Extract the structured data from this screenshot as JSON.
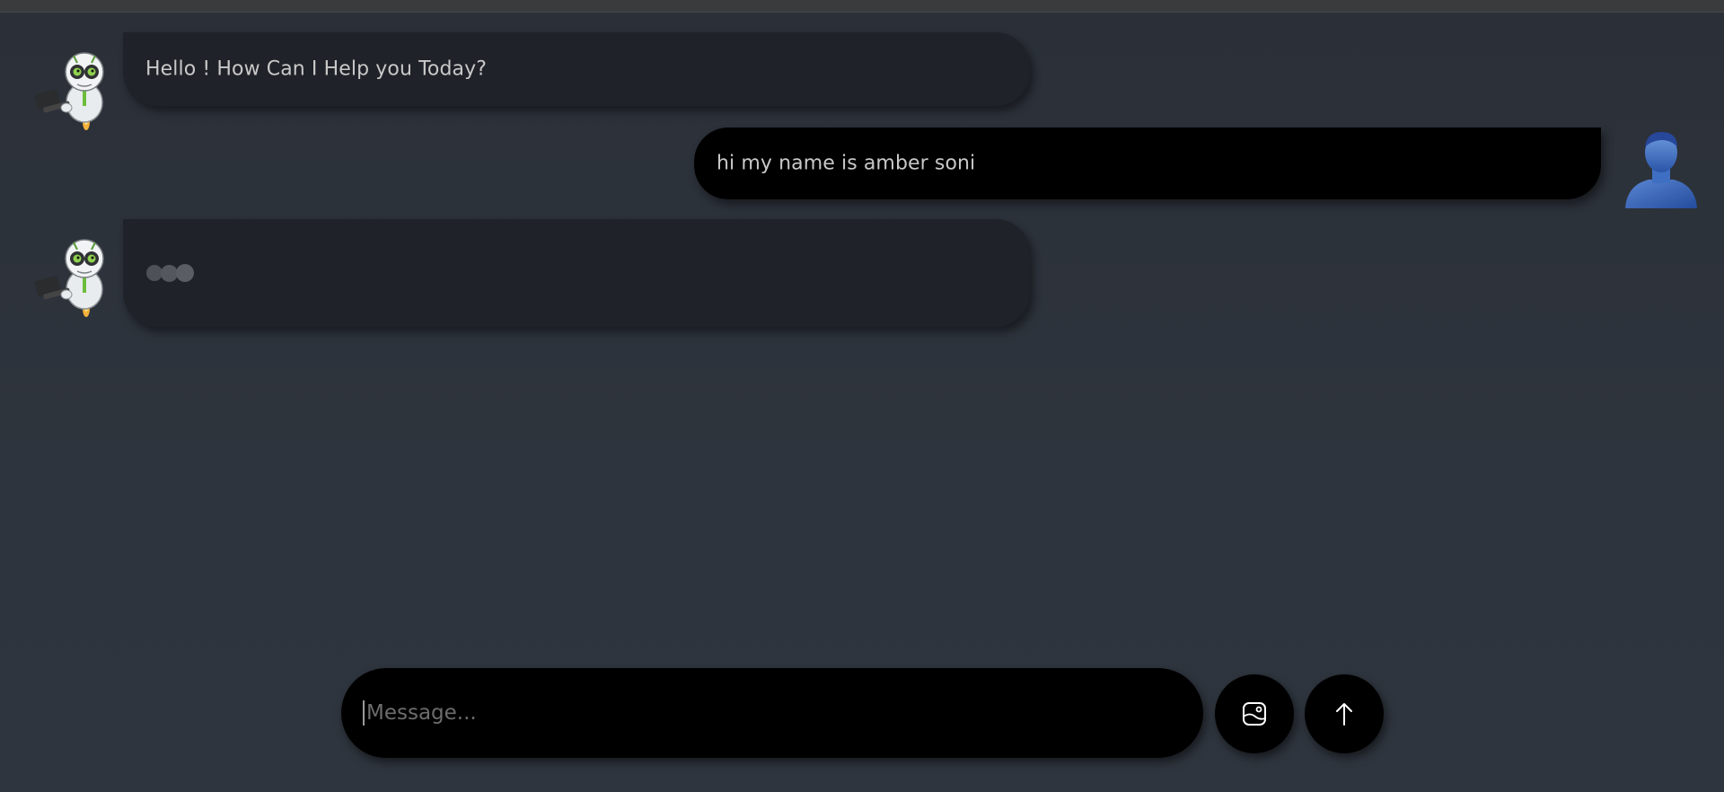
{
  "chat": {
    "messages": [
      {
        "sender": "bot",
        "text": "Hello ! How Can I Help you Today?"
      },
      {
        "sender": "user",
        "text": "hi my name is amber soni"
      },
      {
        "sender": "bot",
        "typing": true
      }
    ]
  },
  "composer": {
    "placeholder": "Message...",
    "value": ""
  },
  "icons": {
    "bot_avatar": "robot-avatar-icon",
    "user_avatar": "user-avatar-icon",
    "image_button": "image-upload-icon",
    "send_button": "arrow-up-icon"
  },
  "colors": {
    "background": "#2e343d",
    "bot_bubble": "#1f2228",
    "user_bubble": "#000000",
    "text": "#c9c9c9"
  }
}
